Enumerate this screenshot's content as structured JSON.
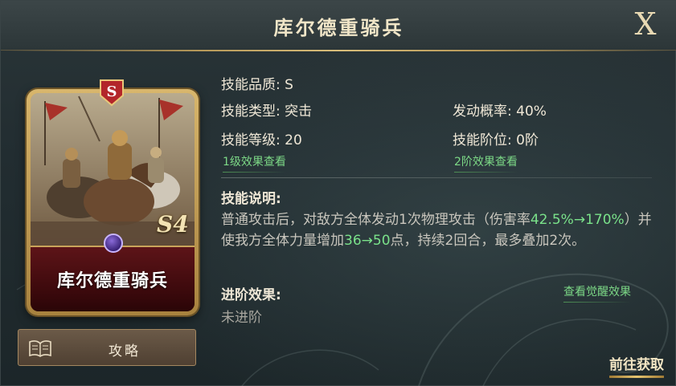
{
  "header": {
    "title": "库尔德重骑兵",
    "close_label": "X"
  },
  "card": {
    "name": "库尔德重骑兵",
    "grade_badge": "S",
    "level_badge": "S4"
  },
  "guide_button": {
    "label": "攻略",
    "icon": "book-icon"
  },
  "skill": {
    "quality": "技能品质: S",
    "type": "技能类型: 突击",
    "trigger_rate": "发动概率: 40%",
    "level": "技能等级: 20",
    "tier": "技能阶位: 0阶",
    "link_level1": "1级效果查看",
    "link_tier2": "2阶效果查看",
    "desc_title": "技能说明:",
    "desc": {
      "p1": "普通攻击后，对敌方全体发动1次物理攻击（伤害率",
      "dmg_range": "42.5%→170%",
      "p2": "）并使我方全体力量增加",
      "str_range": "36→50",
      "p3": "点，持续2回合，最多叠加2次。"
    },
    "advance_title": "进阶效果:",
    "advance_value": "未进阶",
    "awaken_link": "查看觉醒效果",
    "goto_label": "前往获取"
  },
  "colors": {
    "highlight": "#7ae28a",
    "gold": "#d8bd7a",
    "card_red": "#5d1418"
  }
}
